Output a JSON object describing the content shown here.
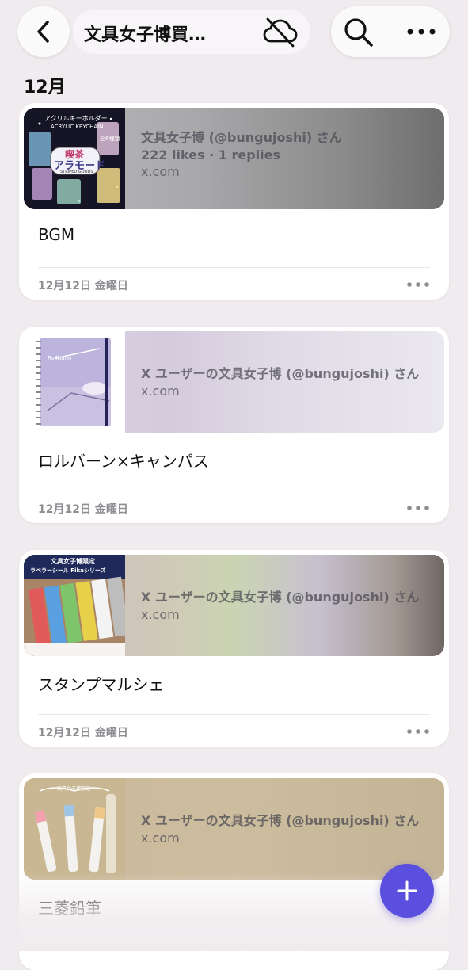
{
  "header": {
    "title": "文具女子博買…",
    "back_icon": "chevron-left-icon",
    "cloud_icon": "cloud-off-icon",
    "search_icon": "search-icon",
    "more_icon": "more-horizontal-icon"
  },
  "section": {
    "label": "12月"
  },
  "cards": [
    {
      "thumb_text": [
        "アクリルキーホルダー",
        "ACRYLIC KEYCHAIN",
        "喫茶",
        "アラモード",
        "STRIPED GOODS",
        "全6種類"
      ],
      "link_title": "文具女子博 (@bungujoshi) さん",
      "link_meta": "222 likes · 1 replies",
      "link_domain": "x.com",
      "title": "BGM",
      "date": "12月12日 金曜日"
    },
    {
      "thumb_text": [
        "Rollbahn"
      ],
      "link_title": "X ユーザーの文具女子博 (@bungujoshi) さん",
      "link_domain": "x.com",
      "title": "ロルバーン×キャンパス",
      "date": "12月12日 金曜日"
    },
    {
      "thumb_text": [
        "文具女子博限定",
        "ラベラーシール Fikaシリーズ"
      ],
      "link_title": "X ユーザーの文具女子博 (@bungujoshi) さん",
      "link_domain": "x.com",
      "title": "スタンプマルシェ",
      "date": "12月12日 金曜日"
    },
    {
      "thumb_text": [
        "文具女子博限定"
      ],
      "link_title": "X ユーザーの文具女子博 (@bungujoshi) さん",
      "link_domain": "x.com",
      "title": "三菱鉛筆"
    }
  ],
  "fab": {
    "icon": "plus-icon",
    "color": "#5b4fe0"
  }
}
